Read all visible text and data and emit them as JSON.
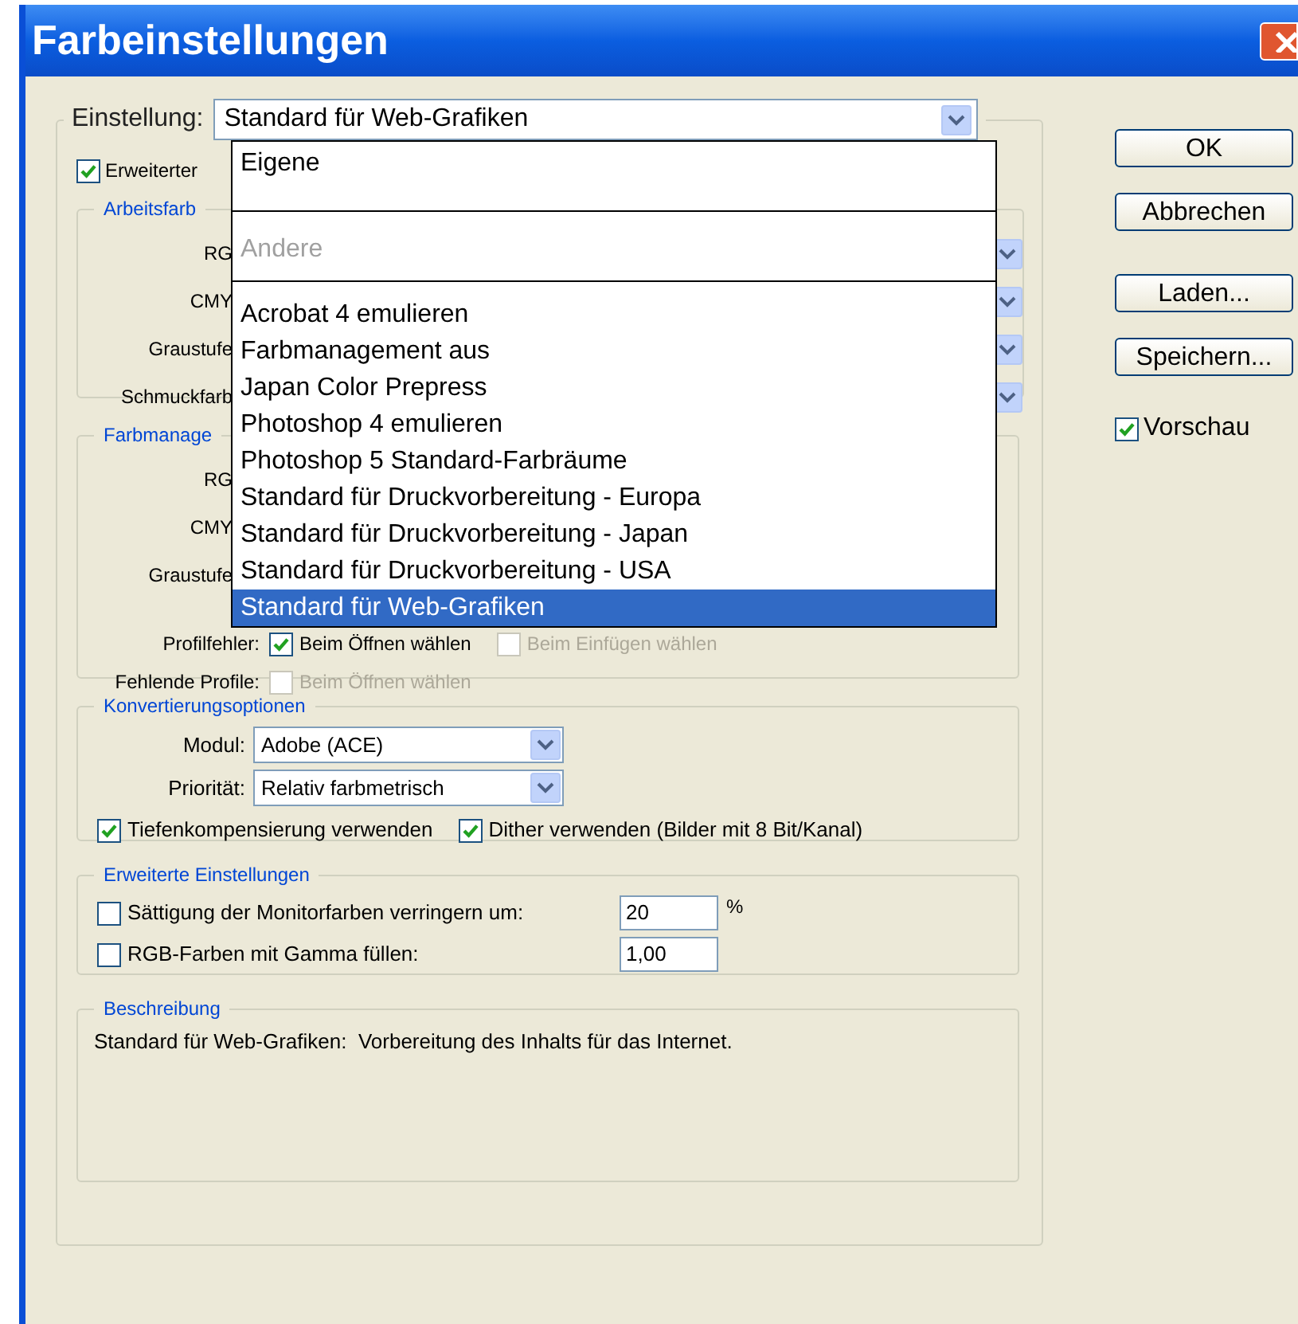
{
  "window": {
    "title": "Farbeinstellungen"
  },
  "setting": {
    "label": "Einstellung:",
    "value": "Standard für Web-Grafiken",
    "expanded": true,
    "options": [
      {
        "label": "Eigene",
        "kind": "group",
        "disabled": false,
        "selected": false
      },
      {
        "label": "Andere",
        "kind": "group",
        "disabled": true,
        "selected": false
      },
      {
        "label": "Acrobat 4 emulieren",
        "kind": "item",
        "disabled": false,
        "selected": false
      },
      {
        "label": "Farbmanagement aus",
        "kind": "item",
        "disabled": false,
        "selected": false
      },
      {
        "label": "Japan Color Prepress",
        "kind": "item",
        "disabled": false,
        "selected": false
      },
      {
        "label": "Photoshop 4 emulieren",
        "kind": "item",
        "disabled": false,
        "selected": false
      },
      {
        "label": "Photoshop 5 Standard-Farbräume",
        "kind": "item",
        "disabled": false,
        "selected": false
      },
      {
        "label": "Standard für Druckvorbereitung - Europa",
        "kind": "item",
        "disabled": false,
        "selected": false
      },
      {
        "label": "Standard für Druckvorbereitung - Japan",
        "kind": "item",
        "disabled": false,
        "selected": false
      },
      {
        "label": "Standard für Druckvorbereitung - USA",
        "kind": "item",
        "disabled": false,
        "selected": false
      },
      {
        "label": "Standard für Web-Grafiken",
        "kind": "item",
        "disabled": false,
        "selected": true
      }
    ]
  },
  "advanced_mode": {
    "label": "Erweiterter",
    "checked": true
  },
  "working_spaces": {
    "title": "Arbeitsfarb",
    "rows": [
      "RG",
      "CMY",
      "Graustufe",
      "Schmuckfarb"
    ]
  },
  "color_management": {
    "title": "Farbmanage",
    "rows": [
      "RG",
      "CMY",
      "Graustufe"
    ],
    "checks": [
      {
        "label": "Profilfehler:",
        "options": [
          {
            "label": "Beim Öffnen wählen",
            "checked": true,
            "disabled": false
          },
          {
            "label": "Beim Einfügen wählen",
            "checked": false,
            "disabled": true
          }
        ]
      },
      {
        "label": "Fehlende Profile:",
        "options": [
          {
            "label": "Beim Öffnen wählen",
            "checked": false,
            "disabled": true
          }
        ]
      }
    ]
  },
  "conversion": {
    "title": "Konvertierungsoptionen",
    "selects": [
      {
        "label": "Modul:",
        "value": "Adobe (ACE)"
      },
      {
        "label": "Priorität:",
        "value": "Relativ farbmetrisch"
      }
    ],
    "checks": [
      {
        "label": "Tiefenkompensierung verwenden",
        "checked": true
      },
      {
        "label": "Dither verwenden (Bilder mit 8 Bit/Kanal)",
        "checked": true
      }
    ]
  },
  "advanced": {
    "title": "Erweiterte Einstellungen",
    "rows": [
      {
        "label": "Sättigung der Monitorfarben verringern um:",
        "checked": false,
        "value": "20",
        "unit": "%"
      },
      {
        "label": "RGB-Farben mit Gamma füllen:",
        "checked": false,
        "value": "1,00"
      }
    ]
  },
  "description": {
    "title": "Beschreibung",
    "text": "Standard für Web-Grafiken:  Vorbereitung des Inhalts für das Internet."
  },
  "buttons": [
    "OK",
    "Abbrechen",
    "Laden...",
    "Speichern..."
  ],
  "preview": {
    "label": "Vorschau",
    "checked": true
  }
}
